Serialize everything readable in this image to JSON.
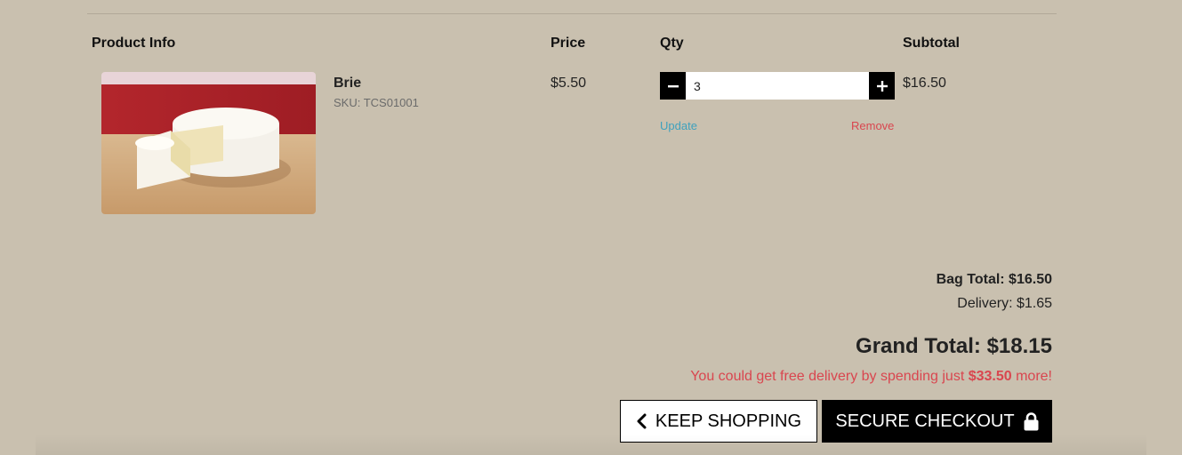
{
  "table": {
    "headers": {
      "product": "Product Info",
      "price": "Price",
      "qty": "Qty",
      "subtotal": "Subtotal"
    }
  },
  "item": {
    "name": "Brie",
    "sku": "SKU: TCS01001",
    "price": "$5.50",
    "quantity": "3",
    "update_label": "Update",
    "remove_label": "Remove",
    "subtotal": "$16.50",
    "image_icon": "brie-cheese-photo"
  },
  "totals": {
    "bag_total": "Bag Total: $16.50",
    "delivery": "Delivery: $1.65",
    "grand_total": "Grand Total: $18.15",
    "free_delivery_prefix": "You could get free delivery by spending just ",
    "free_delivery_amount": "$33.50",
    "free_delivery_suffix": " more!"
  },
  "actions": {
    "keep_shopping": "KEEP SHOPPING",
    "secure_checkout": "SECURE CHECKOUT"
  },
  "colors": {
    "background": "#c9c0af",
    "link_update": "#3fa1bd",
    "link_remove": "#d9464f",
    "button_dark": "#000000"
  }
}
